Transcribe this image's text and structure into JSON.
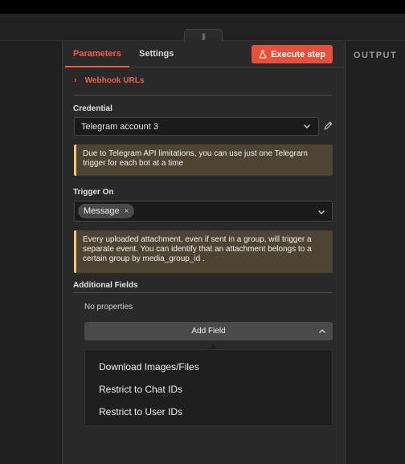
{
  "tabs": {
    "parameters": "Parameters",
    "settings": "Settings"
  },
  "execute_button": {
    "label": "Execute step",
    "icon": "flask-icon"
  },
  "webhook_section": {
    "label": "Webhook URLs"
  },
  "credential": {
    "label": "Credential",
    "value": "Telegram account 3"
  },
  "notices": {
    "bot_limit": "Due to Telegram API limitations, you can use just one Telegram trigger for each bot at a time",
    "attachments": "Every uploaded attachment, even if sent in a group, will trigger a separate event. You can identify that an attachment belongs to a certain group by media_group_id ."
  },
  "trigger_on": {
    "label": "Trigger On",
    "selected": [
      "Message"
    ],
    "remove_glyph": "×"
  },
  "additional_fields": {
    "label": "Additional Fields",
    "empty_text": "No properties",
    "add_button": "Add Field",
    "options": [
      "Download Images/Files",
      "Restrict to Chat IDs",
      "Restrict to User IDs"
    ]
  },
  "output_panel": {
    "label": "OUTPUT"
  },
  "colors": {
    "accent": "#ef5f46",
    "execute_bg": "#e9503b",
    "notice_bg": "#4f4334",
    "notice_border": "#f3c56c"
  }
}
